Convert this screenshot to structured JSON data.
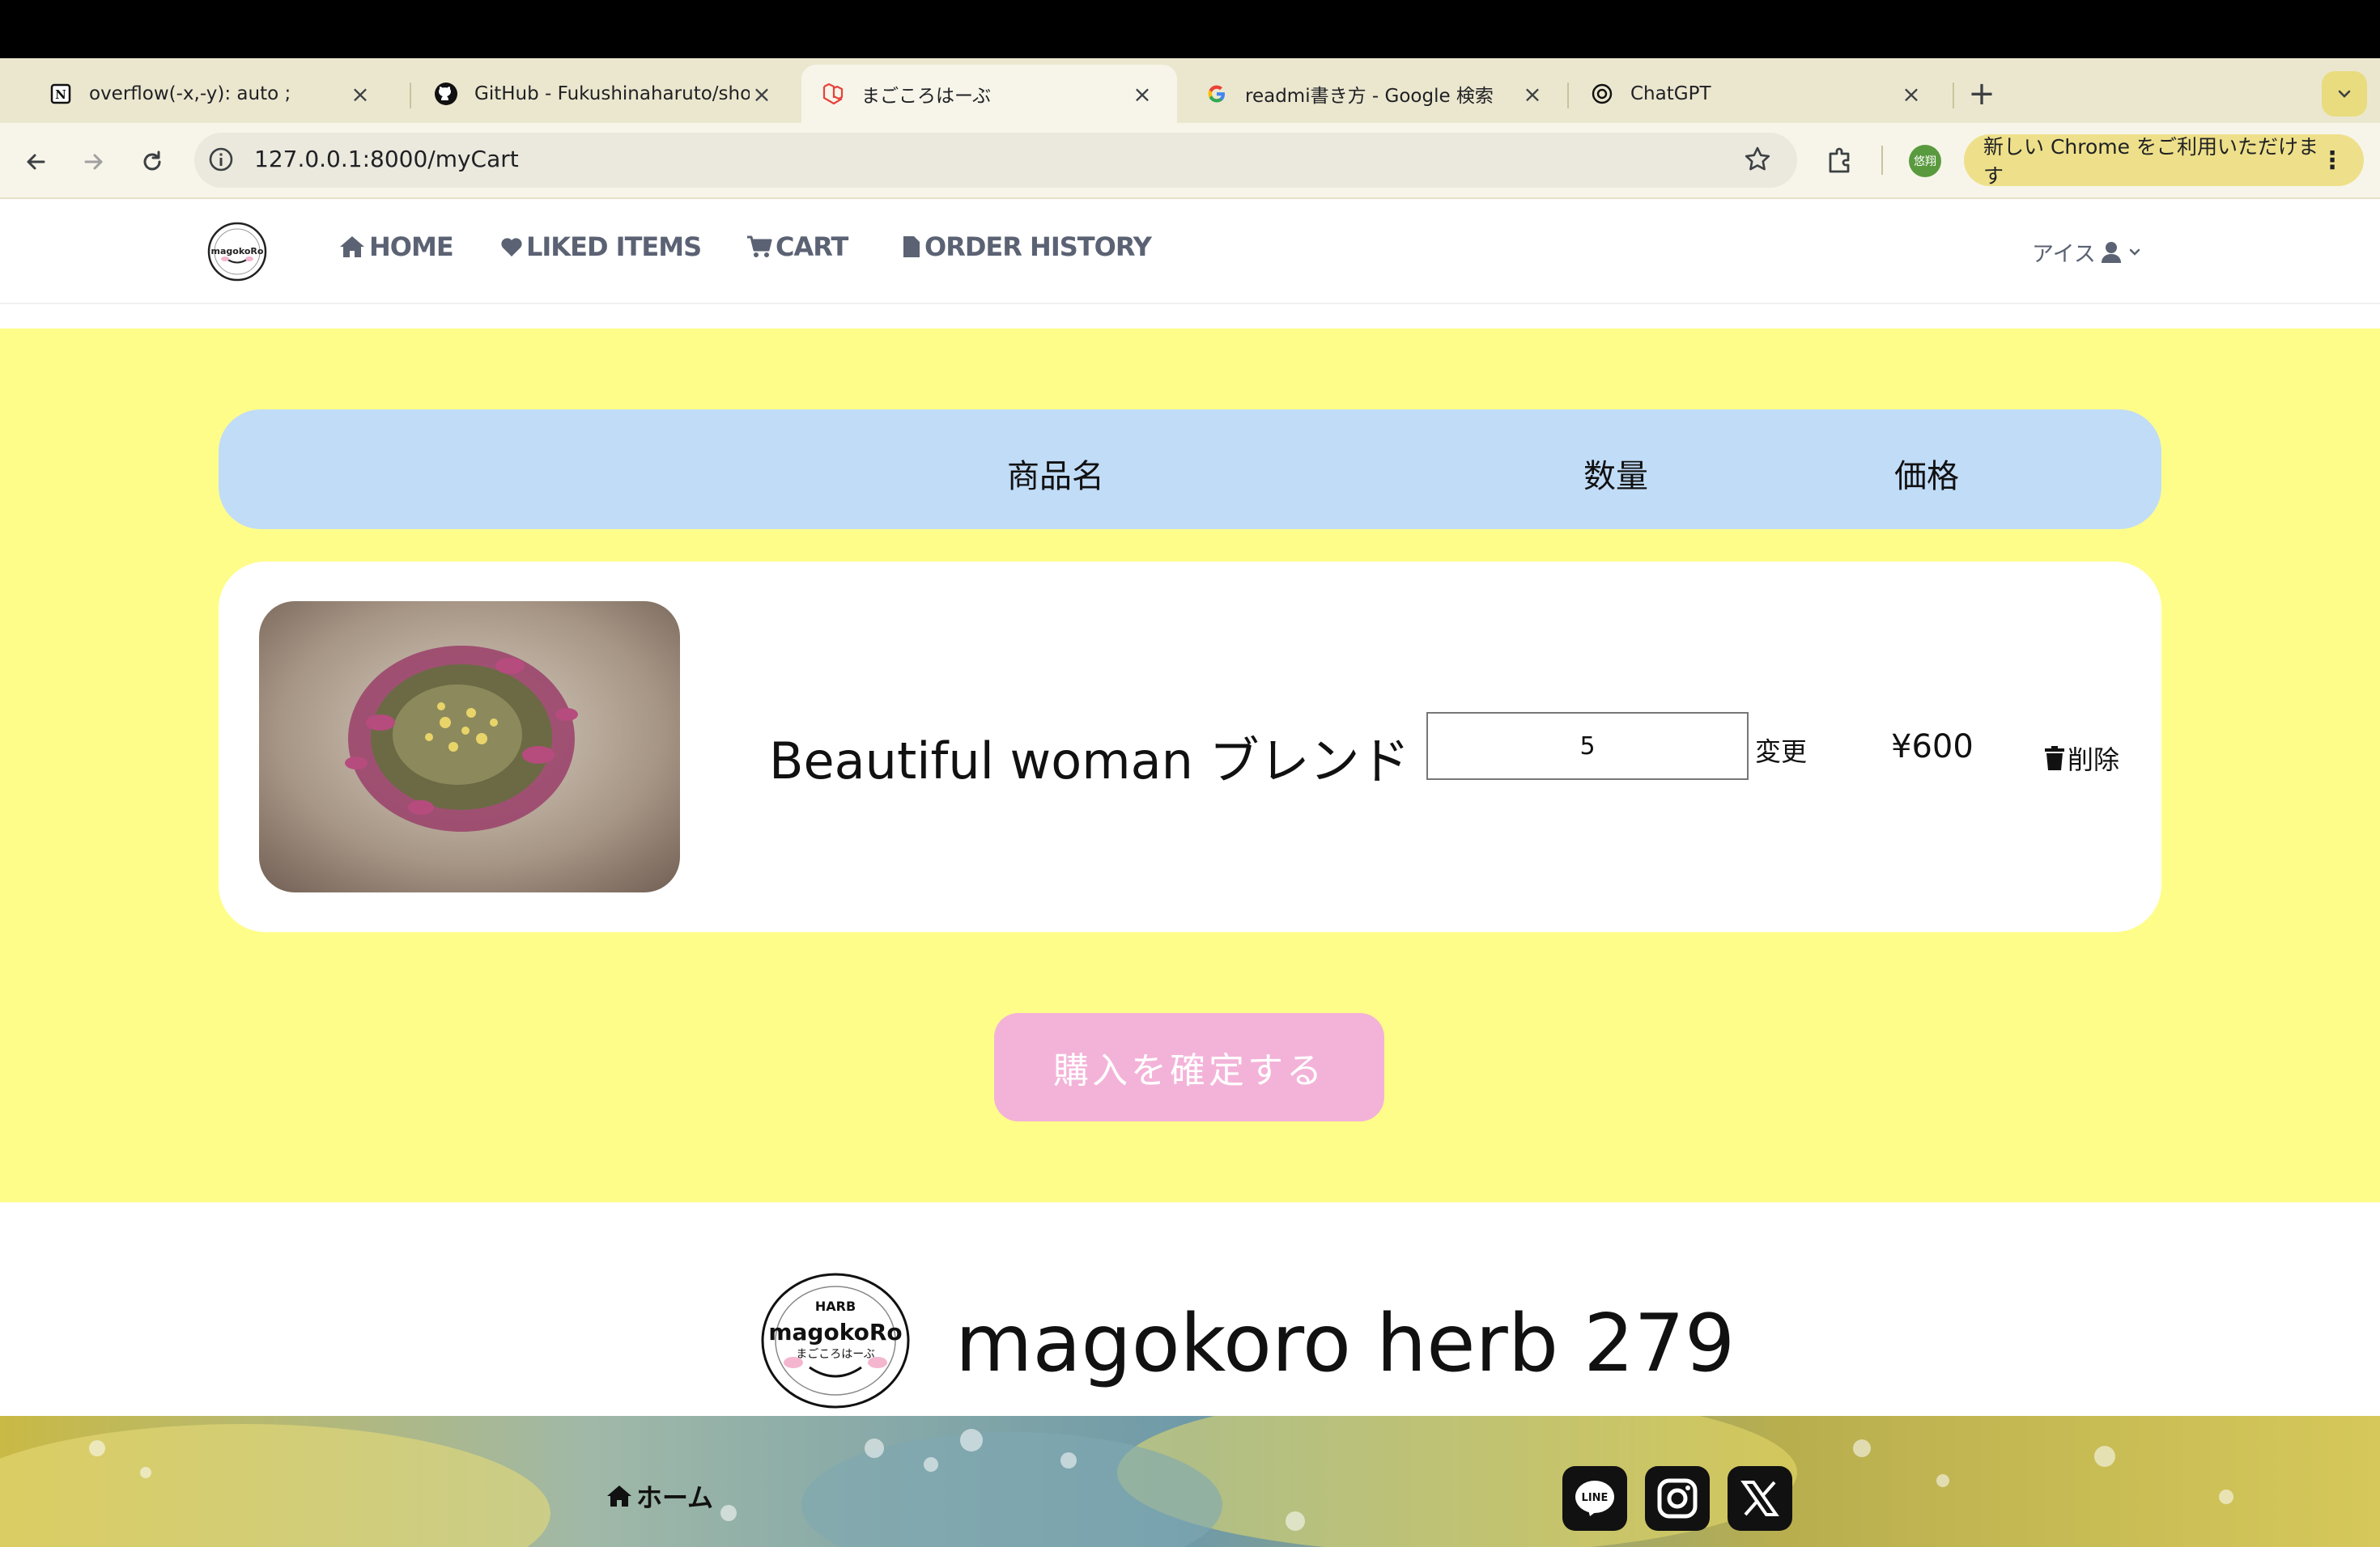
{
  "browser": {
    "tabs": [
      {
        "title": "overflow(-x,-y): auto ;",
        "icon": "notion-icon"
      },
      {
        "title": "GitHub - Fukushinaharuto/sho",
        "icon": "github-icon"
      },
      {
        "title": "まごころはーぶ",
        "icon": "laravel-icon",
        "active": true
      },
      {
        "title": "readmi書き方 - Google 検索",
        "icon": "google-icon"
      },
      {
        "title": "ChatGPT",
        "icon": "chatgpt-icon"
      }
    ],
    "url": "127.0.0.1:8000/myCart",
    "profile_label": "悠翔",
    "banner": "新しい Chrome をご利用いただけます"
  },
  "nav": {
    "home": "HOME",
    "liked": "LIKED ITEMS",
    "cart": "CART",
    "history": "ORDER HISTORY",
    "user": "アイス"
  },
  "cart": {
    "headers": {
      "name": "商品名",
      "quantity": "数量",
      "price": "価格"
    },
    "items": [
      {
        "name": "Beautiful woman ブレンド",
        "quantity": "5",
        "price": "¥600",
        "change_label": "変更",
        "delete_label": "削除"
      }
    ],
    "confirm_label": "購入を確定する"
  },
  "footer": {
    "brand": "magokoro herb 279",
    "logo_top": "HARB",
    "logo_main": "magokoRo",
    "logo_sub": "まごころはーぶ",
    "home_link": "ホーム",
    "social_icons": [
      "line-icon",
      "instagram-icon",
      "x-icon"
    ],
    "line_label": "LINE"
  },
  "colors": {
    "main_bg": "#fffd8a",
    "header_bar": "#c1dcf7",
    "confirm_button": "#f3b3d8",
    "nav_text": "#5b6273"
  }
}
